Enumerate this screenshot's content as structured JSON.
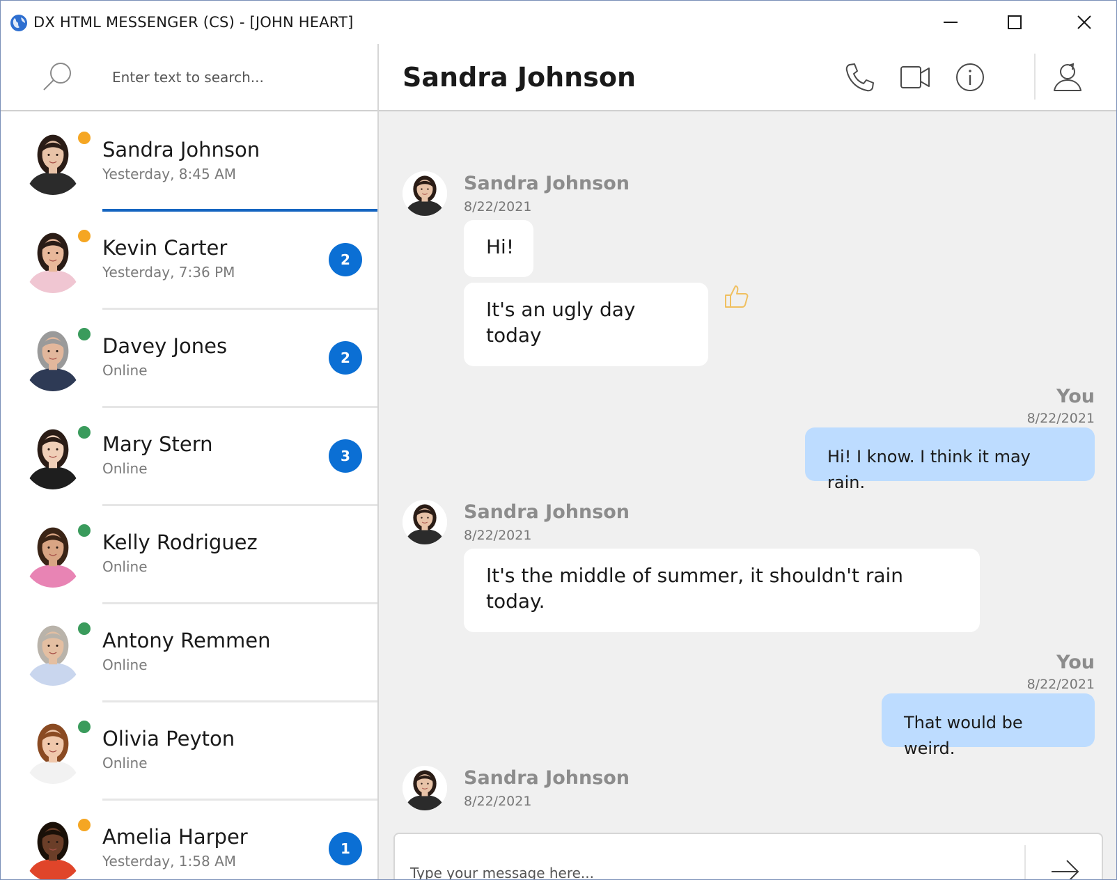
{
  "window": {
    "title": "DX HTML MESSENGER (CS) - [JOHN HEART]"
  },
  "search": {
    "placeholder": "Enter text to search..."
  },
  "contacts": [
    {
      "name": "Sandra Johnson",
      "sub": "Yesterday, 8:45 AM",
      "status_color": "#f5a623",
      "badge": "",
      "skin": "#e8c3a8",
      "hair": "#2a1c16",
      "shirt": "#2b2b2b"
    },
    {
      "name": "Kevin Carter",
      "sub": "Yesterday, 7:36 PM",
      "status_color": "#f5a623",
      "badge": "2",
      "skin": "#e8b89a",
      "hair": "#2a1c16",
      "shirt": "#f0c6d2"
    },
    {
      "name": "Davey Jones",
      "sub": "Online",
      "status_color": "#3a9b5c",
      "badge": "2",
      "skin": "#e2b79c",
      "hair": "#9a9a9a",
      "shirt": "#2e3a55"
    },
    {
      "name": "Mary Stern",
      "sub": "Online",
      "status_color": "#3a9b5c",
      "badge": "3",
      "skin": "#f0cfb8",
      "hair": "#2a1c16",
      "shirt": "#1e1e1e"
    },
    {
      "name": "Kelly Rodriguez",
      "sub": "Online",
      "status_color": "#3a9b5c",
      "badge": "",
      "skin": "#d9a584",
      "hair": "#3a2416",
      "shirt": "#e884b4"
    },
    {
      "name": "Antony Remmen",
      "sub": "Online",
      "status_color": "#3a9b5c",
      "badge": "",
      "skin": "#e4bfa2",
      "hair": "#b9b3aa",
      "shirt": "#c9d6ee"
    },
    {
      "name": "Olivia Peyton",
      "sub": "Online",
      "status_color": "#3a9b5c",
      "badge": "",
      "skin": "#f0c8ac",
      "hair": "#8a4a22",
      "shirt": "#f2f2f2"
    },
    {
      "name": "Amelia Harper",
      "sub": "Yesterday, 1:58 AM",
      "status_color": "#f5a623",
      "badge": "1",
      "skin": "#6b3e28",
      "hair": "#1a1008",
      "shirt": "#e0452a"
    }
  ],
  "chat": {
    "title": "Sandra Johnson",
    "messages": [
      {
        "author": "Sandra Johnson",
        "date": "8/22/2021",
        "texts": [
          "Hi!",
          "It's an ugly day today"
        ]
      },
      {
        "author": "You",
        "date": "8/22/2021",
        "texts": [
          "Hi! I know. I think it may rain."
        ]
      },
      {
        "author": "Sandra Johnson",
        "date": "8/22/2021",
        "texts": [
          "It's the middle of summer, it shouldn't rain today."
        ]
      },
      {
        "author": "You",
        "date": "8/22/2021",
        "texts": [
          "That would be weird."
        ]
      },
      {
        "author": "Sandra Johnson",
        "date": "8/22/2021",
        "texts": []
      }
    ],
    "composer_placeholder": "Type your message here..."
  },
  "icons": {
    "app": "globe-icon",
    "minimize": "minimize-icon",
    "maximize": "maximize-icon",
    "close": "close-icon",
    "search": "search-icon",
    "phone": "phone-icon",
    "video": "video-camera-icon",
    "info": "info-icon",
    "profile": "user-profile-icon",
    "like": "thumbs-up-icon",
    "send": "send-arrow-icon"
  },
  "colors": {
    "accent": "#1565c0",
    "badge": "#0b6fd4",
    "away": "#f5a623",
    "online": "#3a9b5c",
    "my_bubble": "#bddcff",
    "like": "#f0c060"
  }
}
